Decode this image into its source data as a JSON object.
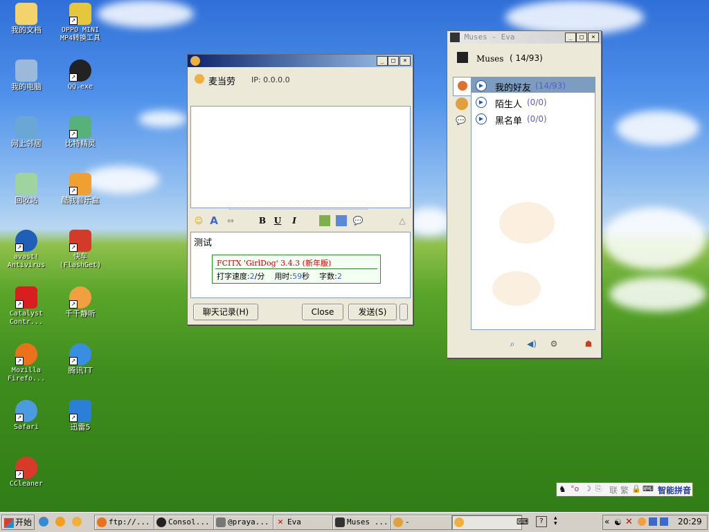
{
  "desktop": {
    "icons": [
      {
        "label": "我的文档",
        "icon": "folder-icon"
      },
      {
        "label": "OPPO MINI MP4转换工具",
        "icon": "converter-icon"
      },
      {
        "label": "我的电脑",
        "icon": "computer-icon"
      },
      {
        "label": "QQ.exe",
        "icon": "qq-penguin-icon"
      },
      {
        "label": "网上邻居",
        "icon": "network-icon"
      },
      {
        "label": "比特精灵",
        "icon": "bitspirit-icon"
      },
      {
        "label": "回收站",
        "icon": "recycle-bin-icon"
      },
      {
        "label": "酷我音乐盒",
        "icon": "music-box-icon"
      },
      {
        "label": "avast! Antivirus",
        "icon": "avast-icon"
      },
      {
        "label": "快车 (FlashGet)",
        "icon": "flashget-icon"
      },
      {
        "label": "Catalyst Contr...",
        "icon": "ati-icon"
      },
      {
        "label": "千千静听",
        "icon": "ttplayer-icon"
      },
      {
        "label": "Mozilla Firefo...",
        "icon": "firefox-icon"
      },
      {
        "label": "腾讯TT",
        "icon": "tencent-tt-icon"
      },
      {
        "label": "Safari",
        "icon": "safari-icon"
      },
      {
        "label": "迅雷5",
        "icon": "thunder-icon"
      },
      {
        "label": "CCleaner",
        "icon": "ccleaner-icon"
      }
    ]
  },
  "chat_window": {
    "contact_name": "麦当劳",
    "ip_text": "IP: 0.0.0.0",
    "input_text": "测试",
    "ime_popup": {
      "title": "FCITX 'GirlDog' 3.4.3 (新年版)",
      "speed_label": "打字速度:",
      "speed_value": "2",
      "speed_unit": "/分",
      "time_label": "用时:",
      "time_value": "59",
      "time_unit": "秒",
      "count_label": "字数:",
      "count_value": "2"
    },
    "history_button": "聊天记录(H)",
    "close_button": "Close",
    "send_button": "发送(S)",
    "toolbar": {
      "bold": "B",
      "underline": "U",
      "italic": "I",
      "font": "A"
    }
  },
  "eva_window": {
    "title": "Muses - Eva",
    "user_name": "Muses",
    "count": "( 14/93)",
    "groups": [
      {
        "name": "我的好友",
        "count": "(14/93)"
      },
      {
        "name": "陌生人",
        "count": "(0/0)"
      },
      {
        "name": "黑名单",
        "count": "(0/0)"
      }
    ]
  },
  "taskbar": {
    "start_label": "开始",
    "tasks": [
      {
        "label": "ftp://..."
      },
      {
        "label": "Consol..."
      },
      {
        "label": "@praya..."
      },
      {
        "label": "Eva"
      },
      {
        "label": "Muses ..."
      },
      {
        "label": "-"
      },
      {
        "label": ""
      }
    ],
    "clock": "20:29",
    "tray_arrows": "«"
  },
  "ime_status": {
    "mode_chars": [
      "联",
      "繁"
    ],
    "label": "智能拼音"
  },
  "colors": {
    "titlebar_start": "#0a246a",
    "titlebar_end": "#a6caf0",
    "group_count": "#5a5acd",
    "ime_red": "#cc0000",
    "ime_blue": "#3b5bdb"
  }
}
